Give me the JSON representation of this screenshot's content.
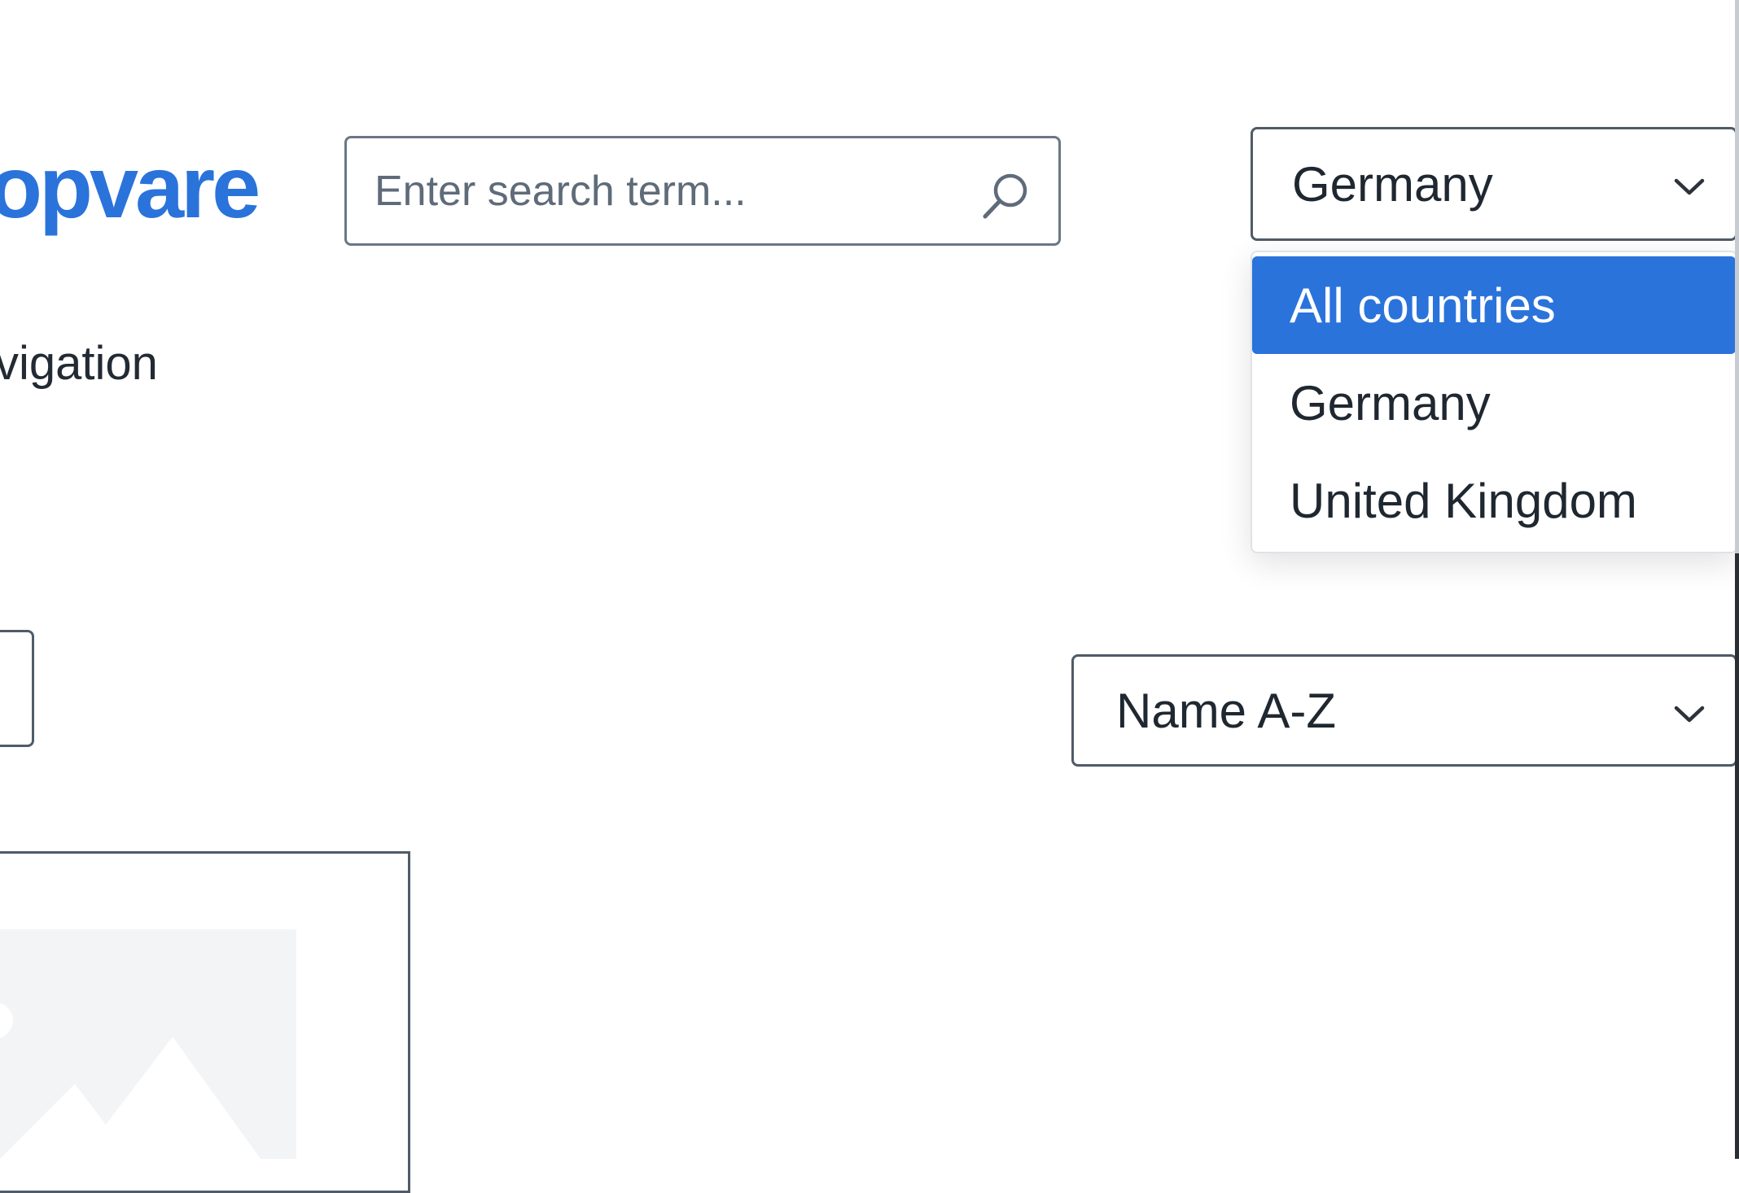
{
  "header": {
    "logo_text": "opvare",
    "search": {
      "placeholder": "Enter search term..."
    },
    "country_select": {
      "selected": "Germany",
      "options": [
        {
          "label": "All countries",
          "highlighted": true
        },
        {
          "label": "Germany",
          "highlighted": false
        },
        {
          "label": "United Kingdom",
          "highlighted": false
        }
      ]
    }
  },
  "navigation": {
    "label": "vigation"
  },
  "sorting": {
    "selected": "Name A-Z"
  },
  "colors": {
    "accent": "#2a73db",
    "border": "#4f5b68",
    "text": "#1f2730",
    "placeholder_bg": "#f3f4f6"
  },
  "icons": {
    "search": "search-icon",
    "dropdown": "chevron-down-icon",
    "product_image": "image-placeholder-icon"
  }
}
